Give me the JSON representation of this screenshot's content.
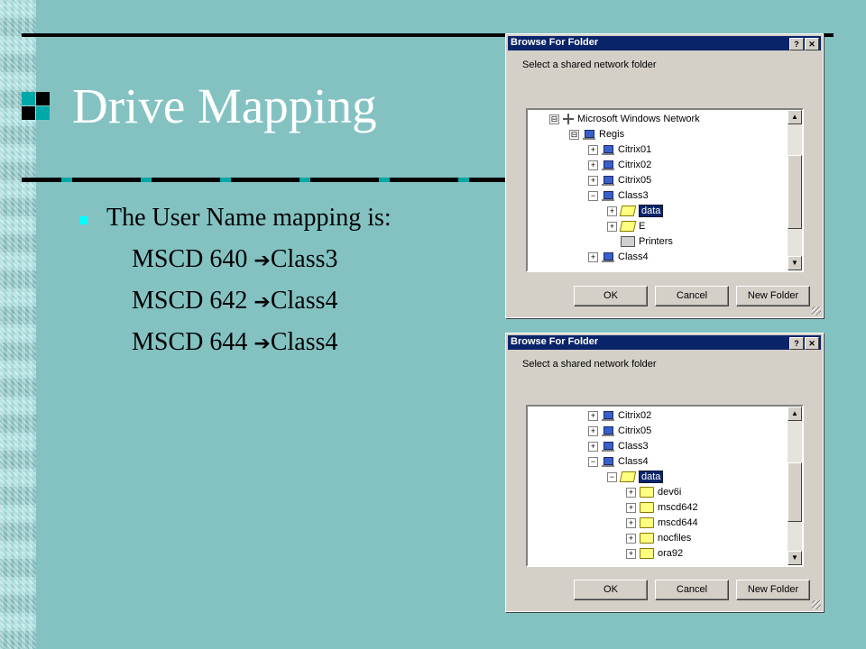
{
  "slide": {
    "title": "Drive Mapping",
    "bullet": "The User Name mapping is:",
    "mappings": [
      {
        "left": "MSCD 640 ",
        "arrow": "➔",
        "right": "Class3"
      },
      {
        "left": "MSCD 642 ",
        "arrow": "➔",
        "right": "Class4"
      },
      {
        "left": "MSCD 644 ",
        "arrow": "➔",
        "right": "Class4"
      }
    ]
  },
  "dialog1": {
    "title": "Browse For Folder",
    "help": "?",
    "close": "✕",
    "prompt": "Select a shared network folder",
    "tree": [
      {
        "label": "Microsoft Windows Network",
        "expander": "⊟",
        "icon": "network-icon"
      },
      {
        "label": "Regis",
        "expander": "⊟",
        "icon": "network-group-icon"
      },
      {
        "label": "Citrix01",
        "expander": "+",
        "icon": "computer-icon"
      },
      {
        "label": "Citrix02",
        "expander": "+",
        "icon": "computer-icon"
      },
      {
        "label": "Citrix05",
        "expander": "+",
        "icon": "computer-icon"
      },
      {
        "label": "Class3",
        "expander": "−",
        "icon": "computer-icon"
      },
      {
        "label": "data",
        "expander": "+",
        "icon": "shared-folder-icon",
        "selected": true
      },
      {
        "label": "E",
        "expander": "+",
        "icon": "shared-folder-icon"
      },
      {
        "label": "Printers",
        "expander": "",
        "icon": "printer-icon"
      },
      {
        "label": "Class4",
        "expander": "+",
        "icon": "computer-icon"
      }
    ],
    "buttons": {
      "ok": "OK",
      "cancel": "Cancel",
      "new_folder": "New Folder"
    }
  },
  "dialog2": {
    "title": "Browse For Folder",
    "help": "?",
    "close": "✕",
    "prompt": "Select a shared network folder",
    "tree": [
      {
        "label": "Citrix02",
        "expander": "+",
        "icon": "computer-icon"
      },
      {
        "label": "Citrix05",
        "expander": "+",
        "icon": "computer-icon"
      },
      {
        "label": "Class3",
        "expander": "+",
        "icon": "computer-icon"
      },
      {
        "label": "Class4",
        "expander": "−",
        "icon": "computer-icon"
      },
      {
        "label": "data",
        "expander": "−",
        "icon": "shared-folder-icon",
        "selected": true
      },
      {
        "label": "dev6i",
        "expander": "+",
        "icon": "folder-icon"
      },
      {
        "label": "mscd642",
        "expander": "+",
        "icon": "folder-icon"
      },
      {
        "label": "mscd644",
        "expander": "+",
        "icon": "folder-icon"
      },
      {
        "label": "nocfiles",
        "expander": "+",
        "icon": "folder-icon"
      },
      {
        "label": "ora92",
        "expander": "+",
        "icon": "folder-icon"
      }
    ],
    "buttons": {
      "ok": "OK",
      "cancel": "Cancel",
      "new_folder": "New Folder"
    }
  }
}
